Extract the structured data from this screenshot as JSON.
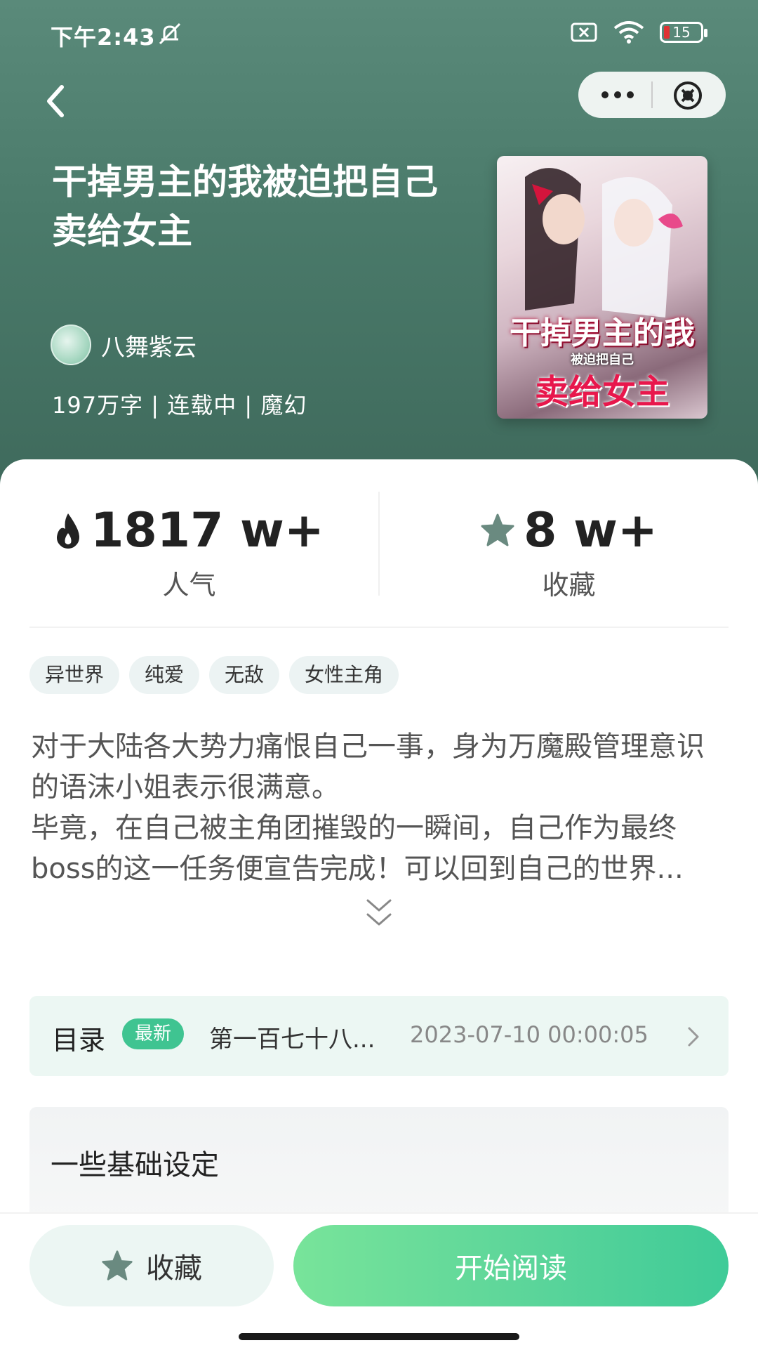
{
  "status_bar": {
    "time": "下午2:43",
    "battery": "15"
  },
  "book": {
    "title": "干掉男主的我被迫把自己卖给女主",
    "author": "八舞紫云",
    "meta": "197万字 | 连载中 | 魔幻",
    "cover_text": {
      "line1": "干掉男主的我",
      "line2": "被迫把自己",
      "line3": "卖给女主"
    }
  },
  "stats": {
    "popularity": {
      "value": "1817 w+",
      "label": "人气"
    },
    "favorites": {
      "value": "8 w+",
      "label": "收藏"
    }
  },
  "tags": [
    "异世界",
    "纯爱",
    "无敌",
    "女性主角"
  ],
  "intro": {
    "p1": "对于大陆各大势力痛恨自己一事，身为万魔殿管理意识的语沫小姐表示很满意。",
    "p2_line1": "毕竟，在自己被主角团摧毁的一瞬间，自己作为最终",
    "p2_line2": "boss的这一任务便宣告完成！可以回到自己的世界..."
  },
  "toc": {
    "title": "目录",
    "badge": "最新",
    "chapter": "第一百七十八...",
    "date": "2023-07-10 00:00:05"
  },
  "settings": {
    "title": "一些基础设定"
  },
  "actions": {
    "favorite": "收藏",
    "read": "开始阅读"
  },
  "colors": {
    "accent": "#3fc491",
    "header_bg": "#4a7a6a"
  },
  "icons": {
    "back": "chevron-left-icon",
    "more": "more-dots-icon",
    "close": "close-circle-icon",
    "fire": "fire-icon",
    "star": "star-icon",
    "expand": "double-chevron-down-icon",
    "arrow": "chevron-right-icon"
  }
}
